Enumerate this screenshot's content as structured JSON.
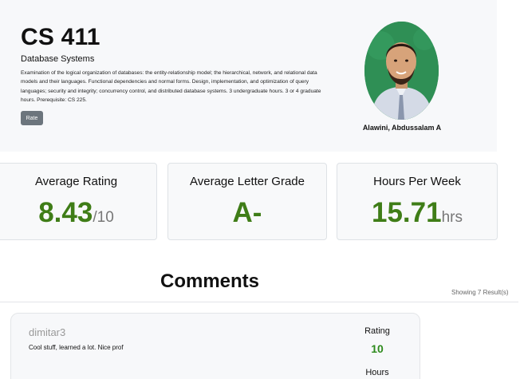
{
  "course": {
    "code": "CS 411",
    "name": "Database Systems",
    "description": "Examination of the logical organization of databases: the entity-relationship model; the hierarchical, network, and relational data models and their languages. Functional dependencies and normal forms. Design, implementation, and optimization of query languages; security and integrity; concurrency control, and distributed database systems. 3 undergraduate hours. 3 or 4 graduate hours. Prerequisite: CS 225.",
    "rate_button_label": "Rate"
  },
  "professor": {
    "name": "Alawini, Abdussalam A"
  },
  "stats": {
    "rating": {
      "title": "Average Rating",
      "value": "8.43",
      "unit": "/10"
    },
    "grade": {
      "title": "Average Letter Grade",
      "value": "A-"
    },
    "hours": {
      "title": "Hours Per Week",
      "value": "15.71",
      "unit": "hrs"
    }
  },
  "comments": {
    "title": "Comments",
    "results": "Showing 7 Result(s)",
    "items": [
      {
        "user": "dimitar3",
        "text": "Cool stuff, learned a lot. Nice prof",
        "rating_label": "Rating",
        "rating_value": "10",
        "hours_label": "Hours"
      }
    ]
  },
  "colors": {
    "accent_green": "#3f7d17",
    "rating_green": "#2d8a1c",
    "hero_bg": "#f7f8fa",
    "button_gray": "#6c757d",
    "avatar_bg": "#2e8b57"
  }
}
